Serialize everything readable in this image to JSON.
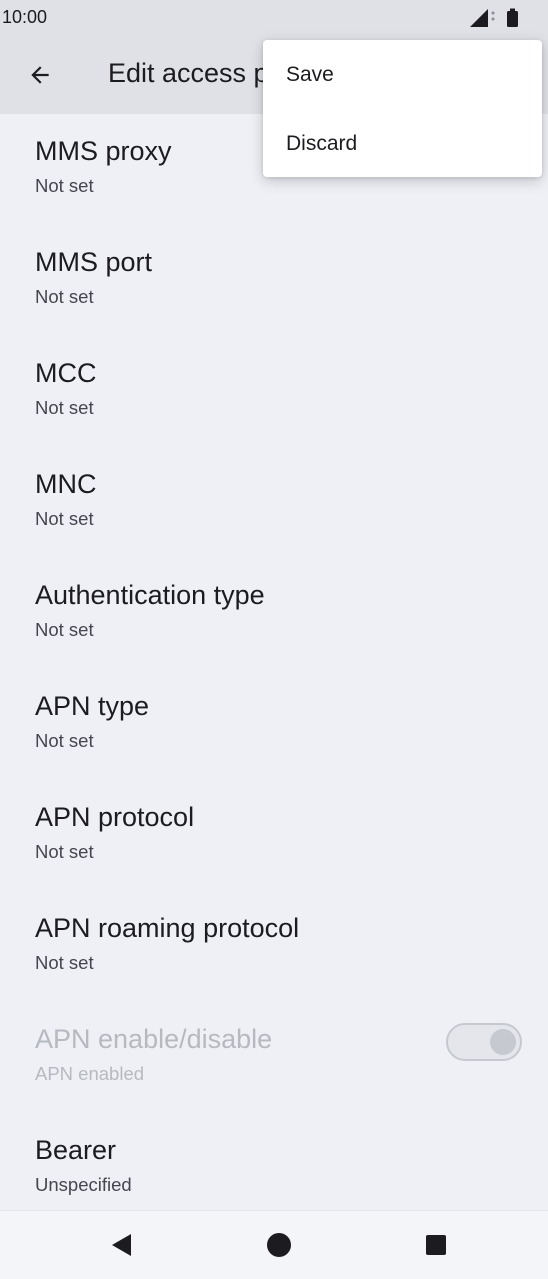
{
  "status_bar": {
    "time": "10:00",
    "icons": [
      "signal-icon",
      "battery-icon"
    ]
  },
  "app_bar": {
    "title": "Edit access point",
    "back_icon": "arrow-back-icon"
  },
  "menu": {
    "items": [
      {
        "label": "Save"
      },
      {
        "label": "Discard"
      }
    ]
  },
  "preferences": {
    "items": [
      {
        "title": "MMS proxy",
        "summary": "Not set"
      },
      {
        "title": "MMS port",
        "summary": "Not set"
      },
      {
        "title": "MCC",
        "summary": "Not set"
      },
      {
        "title": "MNC",
        "summary": "Not set"
      },
      {
        "title": "Authentication type",
        "summary": "Not set"
      },
      {
        "title": "APN type",
        "summary": "Not set"
      },
      {
        "title": "APN protocol",
        "summary": "Not set"
      },
      {
        "title": "APN roaming protocol",
        "summary": "Not set"
      },
      {
        "title": "APN enable/disable",
        "summary": "APN enabled",
        "toggle_on": true,
        "enabled": false
      },
      {
        "title": "Bearer",
        "summary": "Unspecified"
      }
    ]
  },
  "nav_bar": {
    "buttons": [
      "back-nav-icon",
      "home-nav-icon",
      "recents-nav-icon"
    ]
  },
  "colors": {
    "bar_background": "#dfe1e7",
    "page_background": "#eef0f6",
    "text_primary": "#1c1b1f",
    "text_secondary": "#45464f",
    "text_disabled": "#b7b9c0"
  }
}
